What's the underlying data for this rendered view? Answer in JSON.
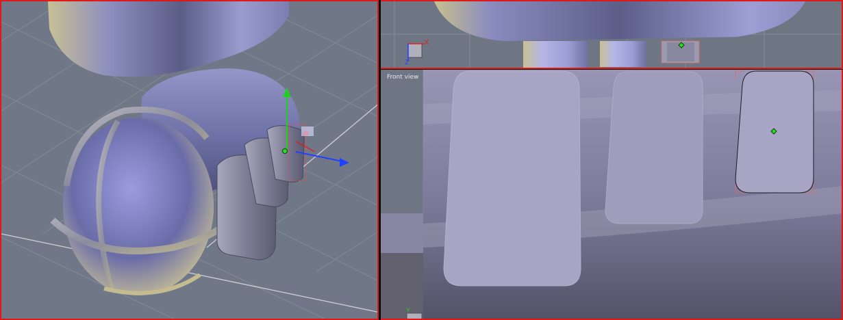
{
  "viewports": {
    "perspective": {
      "label": ""
    },
    "top": {
      "axis_labels": {
        "x": "X",
        "z": "Z"
      }
    },
    "front": {
      "label": "Front view",
      "axis_labels": {
        "y": "Y"
      }
    }
  },
  "colors": {
    "active_border": "#e01818",
    "grid_background": "#707887",
    "gizmo_x": "#e02020",
    "gizmo_y": "#20d020",
    "gizmo_z": "#2040ff",
    "pivot": "#22e022"
  },
  "icons": [
    "move-gizmo-icon",
    "axis-indicator-icon",
    "pivot-marker-icon"
  ]
}
